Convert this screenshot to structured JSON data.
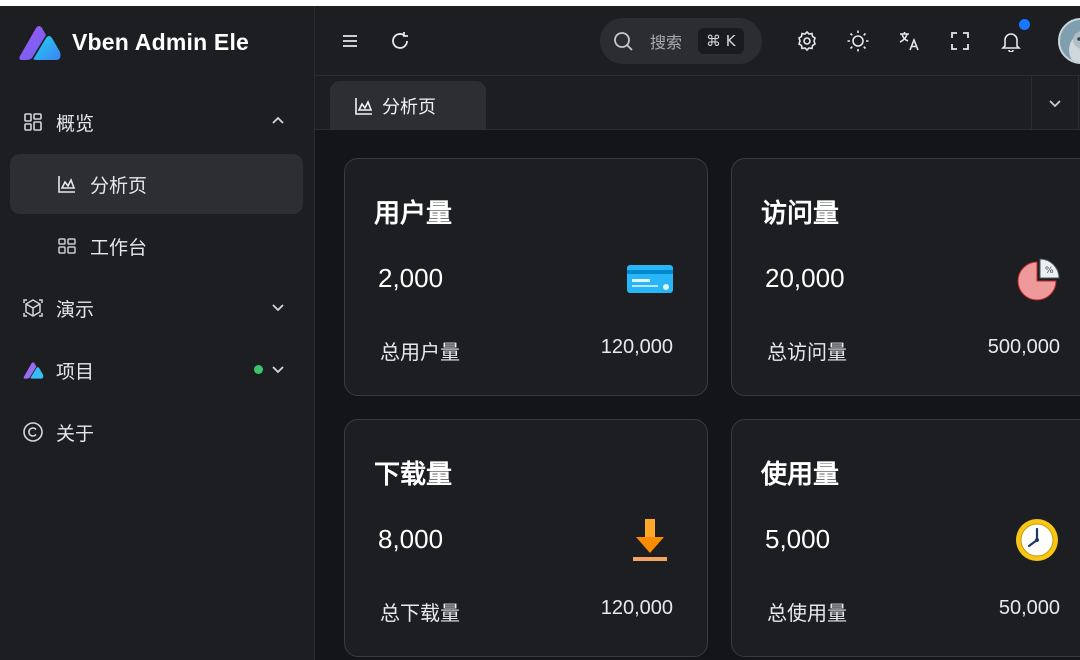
{
  "app": {
    "title": "Vben Admin Ele"
  },
  "sidebar": {
    "items": [
      {
        "label": "概览",
        "icon": "dashboard-grid-icon",
        "expanded": true
      },
      {
        "label": "分析页",
        "icon": "chart-area-icon",
        "active": true
      },
      {
        "label": "工作台",
        "icon": "grid-icon"
      },
      {
        "label": "演示",
        "icon": "cube-icon"
      },
      {
        "label": "项目",
        "icon": "vben-logo-icon",
        "status_color": "#3fc46b"
      },
      {
        "label": "关于",
        "icon": "copyright-icon"
      }
    ]
  },
  "header": {
    "search": {
      "placeholder": "搜索",
      "shortcut": "⌘ K"
    },
    "icons": [
      "menu-icon",
      "refresh-icon",
      "settings-icon",
      "sun-icon",
      "translate-icon",
      "fullscreen-icon",
      "bell-icon"
    ],
    "notification_dot_color": "#1677ff"
  },
  "tabs": [
    {
      "label": "分析页",
      "icon": "chart-area-icon"
    }
  ],
  "cards": [
    {
      "title": "用户量",
      "value": "2,000",
      "footer_label": "总用户量",
      "footer_value": "120,000",
      "icon": "credit-card-icon"
    },
    {
      "title": "访问量",
      "value": "20,000",
      "footer_label": "总访问量",
      "footer_value": "500,000",
      "icon": "pie-percent-icon"
    },
    {
      "title": "下载量",
      "value": "8,000",
      "footer_label": "总下载量",
      "footer_value": "120,000",
      "icon": "download-icon"
    },
    {
      "title": "使用量",
      "value": "5,000",
      "footer_label": "总使用量",
      "footer_value": "50,000",
      "icon": "clock-icon"
    }
  ],
  "colors": {
    "background": "#141518",
    "panel": "#1d1e21",
    "active": "#2d2e33",
    "brand_purple": "#8b5cf6",
    "brand_cyan": "#38bdf8"
  }
}
